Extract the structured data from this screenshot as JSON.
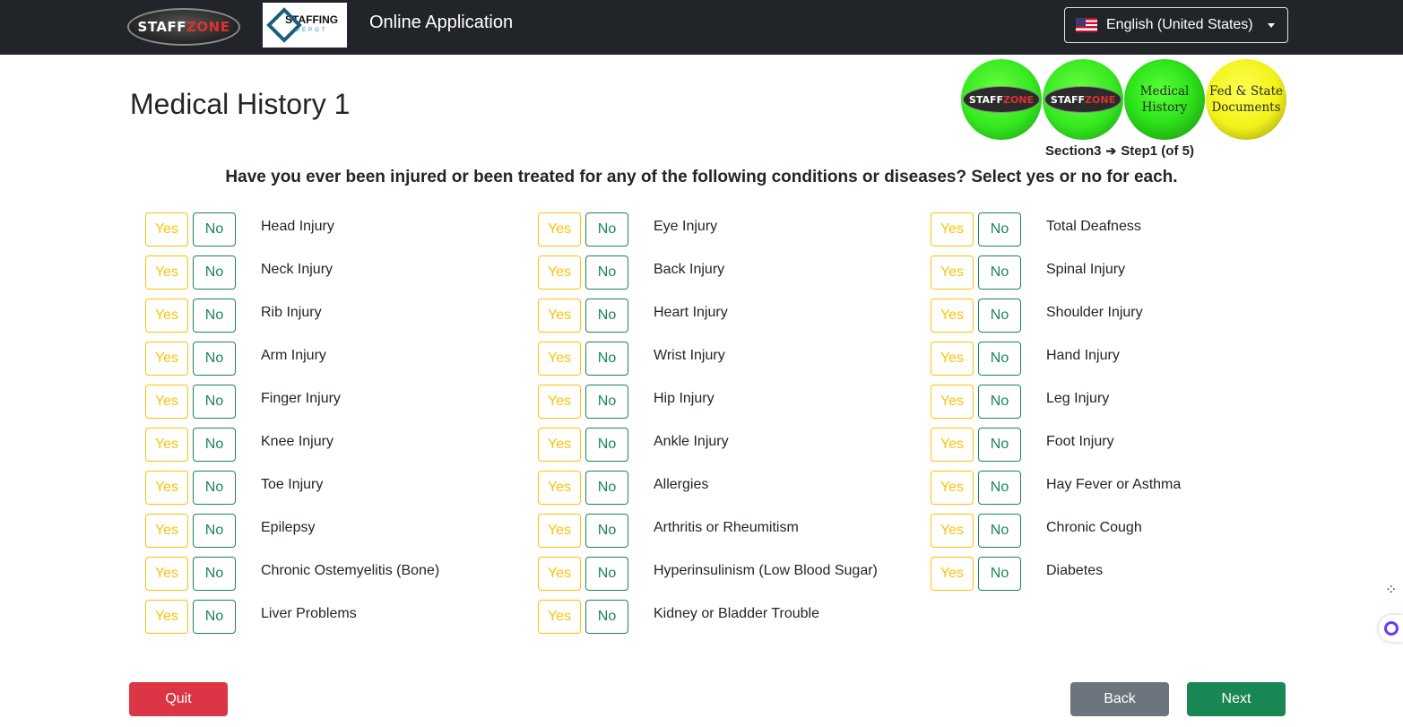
{
  "header": {
    "logo_staffzone": "STAFFZONE",
    "logo_staffzone_a": "STAFF",
    "logo_staffzone_b": "ZONE",
    "logo_staffing_depot": "STAFFING",
    "logo_staffing_depot_sub": "DEPOT",
    "app_title": "Online Application",
    "language": "English (United States)"
  },
  "page": {
    "title": "Medical History 1",
    "steps": [
      {
        "label": "STAFFZONE"
      },
      {
        "label": "STAFFZONE"
      },
      {
        "label_line1": "Medical",
        "label_line2": "History"
      },
      {
        "label_line1": "Fed & State",
        "label_line2": "Documents"
      }
    ],
    "step_section": "Section3",
    "step_detail": "Step1 (of 5)",
    "question": "Have you ever been injured or been treated for any of the following conditions or diseases? Select yes or no for each."
  },
  "options": {
    "yes": "Yes",
    "no": "No"
  },
  "conditions": {
    "col1": [
      "Head Injury",
      "Neck Injury",
      "Rib Injury",
      "Arm Injury",
      "Finger Injury",
      "Knee Injury",
      "Toe Injury",
      "Epilepsy",
      "Chronic Ostemyelitis (Bone)",
      "Liver Problems"
    ],
    "col2": [
      "Eye Injury",
      "Back Injury",
      "Heart Injury",
      "Wrist Injury",
      "Hip Injury",
      "Ankle Injury",
      "Allergies",
      "Arthritis or Rheumitism",
      "Hyperinsulinism (Low Blood Sugar)",
      "Kidney or Bladder Trouble"
    ],
    "col3": [
      "Total Deafness",
      "Spinal Injury",
      "Shoulder Injury",
      "Hand Injury",
      "Leg Injury",
      "Foot Injury",
      "Hay Fever or Asthma",
      "Chronic Cough",
      "Diabetes"
    ]
  },
  "actions": {
    "quit": "Quit",
    "back": "Back",
    "next": "Next"
  },
  "colors": {
    "yes": "#ffc107",
    "no": "#198754",
    "quit": "#dc3545",
    "back": "#6c757d",
    "next": "#198754",
    "header_bg": "#212529"
  }
}
